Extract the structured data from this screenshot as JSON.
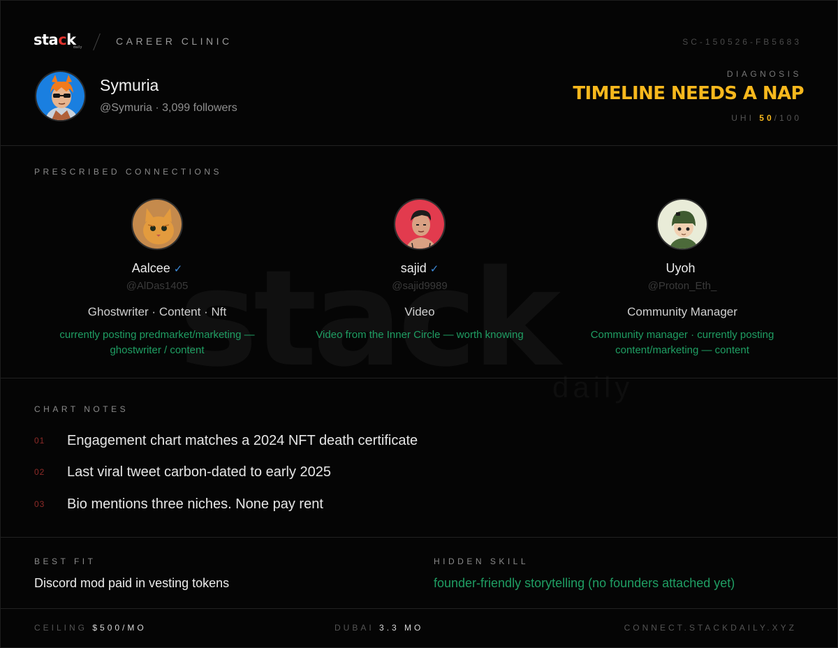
{
  "header": {
    "logo_text": "stack",
    "logo_sub": "daily",
    "section": "CAREER CLINIC",
    "case_id": "SC-150526-FB5683"
  },
  "profile": {
    "name": "Symuria",
    "meta": "@Symuria · 3,099 followers"
  },
  "diagnosis": {
    "label": "DIAGNOSIS",
    "title": "TIMELINE NEEDS A NAP",
    "uhi_label": "UHI",
    "uhi_score": "50",
    "uhi_max": "/100"
  },
  "connections": {
    "label": "PRESCRIBED CONNECTIONS",
    "items": [
      {
        "name": "Aalcee",
        "verified": "✓",
        "handle": "@AlDas1405",
        "role": "Ghostwriter · Content · Nft",
        "note": "currently posting predmarket/marketing — ghostwriter / content"
      },
      {
        "name": "sajid",
        "verified": "✓",
        "handle": "@sajid9989",
        "role": "Video",
        "note": "Video from the Inner Circle — worth knowing"
      },
      {
        "name": "Uyoh",
        "verified": "",
        "handle": "@Proton_Eth_",
        "role": "Community Manager",
        "note": "Community manager · currently posting content/marketing — content"
      }
    ]
  },
  "notes": {
    "label": "CHART NOTES",
    "items": [
      {
        "num": "01",
        "text": "Engagement chart matches a 2024 NFT death certificate"
      },
      {
        "num": "02",
        "text": "Last viral tweet carbon-dated to early 2025"
      },
      {
        "num": "03",
        "text": "Bio mentions three niches. None pay rent"
      }
    ]
  },
  "fit": {
    "best_label": "BEST FIT",
    "best_value": "Discord mod paid in vesting tokens",
    "hidden_label": "HIDDEN SKILL",
    "hidden_value": "founder-friendly storytelling (no founders attached yet)"
  },
  "footer": {
    "ceiling_label": "CEILING",
    "ceiling_value": "$500/MO",
    "dubai_label": "DUBAI",
    "dubai_value": "3.3 MO",
    "url": "CONNECT.STACKDAILY.XYZ"
  },
  "colors": {
    "accent_yellow": "#f7b81d",
    "accent_green": "#1f9e63",
    "accent_red": "#e0312c",
    "verified_blue": "#3d8bd9",
    "background": "#050505"
  }
}
